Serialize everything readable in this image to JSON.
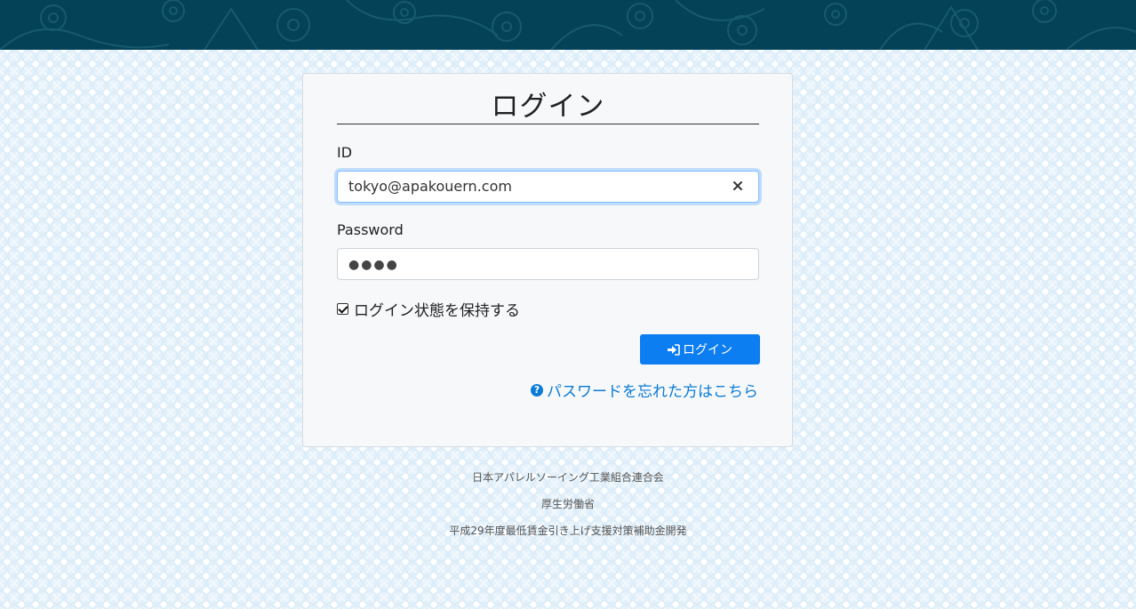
{
  "login": {
    "title": "ログイン",
    "id_label": "ID",
    "id_value": "tokyo@apakouern.com",
    "password_label": "Password",
    "password_masked": "●●●●",
    "remember_label": "ログイン状態を保持する",
    "remember_checked": true,
    "submit_label": "ログイン",
    "forgot_label": "パスワードを忘れた方はこちら"
  },
  "footer": {
    "line1": "日本アパレルソーイング工業組合連合会",
    "line2": "厚生労働省",
    "line3": "平成29年度最低賃金引き上げ支援対策補助金開発"
  },
  "colors": {
    "header_band": "#034257",
    "primary": "#0d7df2",
    "link": "#0a7bd6"
  },
  "icons": {
    "clear": "close-icon",
    "submit": "sign-in-icon",
    "forgot": "question-circle-icon"
  }
}
